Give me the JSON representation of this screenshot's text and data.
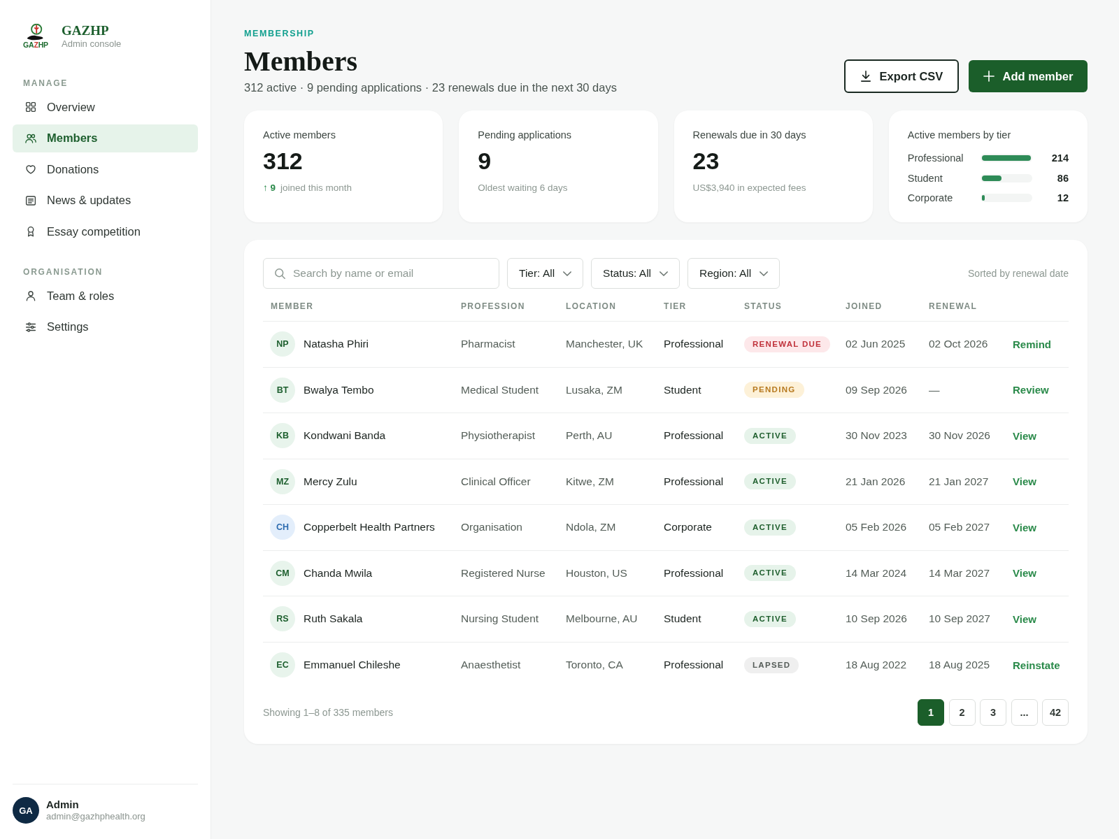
{
  "sidebar": {
    "brand": {
      "logo_text": [
        {
          "text": "GA",
          "color": "#1d6b2f"
        },
        {
          "text": "Z",
          "color": "#c8362e"
        },
        {
          "text": "HP",
          "color": "#1d6b2f"
        }
      ],
      "name": "GAZHP",
      "subtitle": "Admin console"
    },
    "sections": [
      {
        "heading": "MANAGE",
        "items": [
          {
            "label": "Overview",
            "selected": false
          },
          {
            "label": "Members",
            "selected": true
          },
          {
            "label": "Donations",
            "selected": false
          },
          {
            "label": "News & updates",
            "selected": false
          },
          {
            "label": "Essay competition",
            "selected": false
          }
        ]
      },
      {
        "heading": "ORGANISATION",
        "items": [
          {
            "label": "Team & roles",
            "selected": false
          },
          {
            "label": "Settings",
            "selected": false
          }
        ]
      }
    ],
    "user": {
      "initials": "GA",
      "name": "Admin",
      "email": "admin@gazhphealth.org"
    }
  },
  "header": {
    "eyebrow": "MEMBERSHIP",
    "title": "Members",
    "subtitle": "312 active · 9 pending applications · 23 renewals due in the next 30 days",
    "buttons": [
      {
        "label": "Export CSV",
        "kind": "secondary"
      },
      {
        "label": "Add member",
        "kind": "primary"
      }
    ]
  },
  "stat_cards": [
    {
      "kind": "stat",
      "label": "Active members",
      "value": "312",
      "delta": "↑ 9",
      "note": "joined this month"
    },
    {
      "kind": "stat",
      "label": "Pending applications",
      "value": "9",
      "note": "Oldest waiting 6 days"
    },
    {
      "kind": "stat",
      "label": "Renewals due in 30 days",
      "value": "23",
      "note": "US$3,940 in expected fees"
    },
    {
      "kind": "breakdown",
      "label": "Active members by tier",
      "rows": [
        {
          "label": "Professional",
          "level": 1,
          "value": "214"
        },
        {
          "label": "Student",
          "level": 0.4,
          "value": "86"
        },
        {
          "label": "Corporate",
          "level": 0.06,
          "value": "12"
        }
      ]
    }
  ],
  "table": {
    "search": {
      "placeholder": "Search by name or email"
    },
    "filters": [
      "Tier: All",
      "Status: All",
      "Region: All"
    ],
    "sort_note": "Sorted by renewal date",
    "columns": [
      "MEMBER",
      "PROFESSION",
      "LOCATION",
      "TIER",
      "STATUS",
      "JOINED",
      "RENEWAL"
    ],
    "rows": [
      {
        "kind": "person",
        "initials": "NP",
        "name": "Natasha Phiri",
        "profession": "Pharmacist",
        "location": "Manchester, UK",
        "tier": "Professional",
        "status": {
          "label": "RENEWAL DUE",
          "kind": "renewal_due"
        },
        "joined": "02 Jun 2025",
        "renewal": "02 Oct 2026",
        "action": "Remind"
      },
      {
        "kind": "person",
        "initials": "BT",
        "name": "Bwalya Tembo",
        "profession": "Medical Student",
        "location": "Lusaka, ZM",
        "tier": "Student",
        "status": {
          "label": "PENDING",
          "kind": "pending"
        },
        "joined": "09 Sep 2026",
        "renewal": "—",
        "action": "Review"
      },
      {
        "kind": "person",
        "initials": "KB",
        "name": "Kondwani Banda",
        "profession": "Physiotherapist",
        "location": "Perth, AU",
        "tier": "Professional",
        "status": {
          "label": "ACTIVE",
          "kind": "active"
        },
        "joined": "30 Nov 2023",
        "renewal": "30 Nov 2026",
        "action": "View"
      },
      {
        "kind": "person",
        "initials": "MZ",
        "name": "Mercy Zulu",
        "profession": "Clinical Officer",
        "location": "Kitwe, ZM",
        "tier": "Professional",
        "status": {
          "label": "ACTIVE",
          "kind": "active"
        },
        "joined": "21 Jan 2026",
        "renewal": "21 Jan 2027",
        "action": "View"
      },
      {
        "kind": "organisation",
        "initials": "CH",
        "name": "Copperbelt Health Partners",
        "profession": "Organisation",
        "location": "Ndola, ZM",
        "tier": "Corporate",
        "status": {
          "label": "ACTIVE",
          "kind": "active"
        },
        "joined": "05 Feb 2026",
        "renewal": "05 Feb 2027",
        "action": "View"
      },
      {
        "kind": "person",
        "initials": "CM",
        "name": "Chanda Mwila",
        "profession": "Registered Nurse",
        "location": "Houston, US",
        "tier": "Professional",
        "status": {
          "label": "ACTIVE",
          "kind": "active"
        },
        "joined": "14 Mar 2024",
        "renewal": "14 Mar 2027",
        "action": "View"
      },
      {
        "kind": "person",
        "initials": "RS",
        "name": "Ruth Sakala",
        "profession": "Nursing Student",
        "location": "Melbourne, AU",
        "tier": "Student",
        "status": {
          "label": "ACTIVE",
          "kind": "active"
        },
        "joined": "10 Sep 2026",
        "renewal": "10 Sep 2027",
        "action": "View"
      },
      {
        "kind": "person",
        "initials": "EC",
        "name": "Emmanuel Chileshe",
        "profession": "Anaesthetist",
        "location": "Toronto, CA",
        "tier": "Professional",
        "status": {
          "label": "LAPSED",
          "kind": "lapsed"
        },
        "joined": "18 Aug 2022",
        "renewal": "18 Aug 2025",
        "action": "Reinstate"
      }
    ],
    "footer": "Showing 1–8 of 335 members",
    "pages": [
      {
        "label": "1",
        "selected": true
      },
      {
        "label": "2",
        "selected": false
      },
      {
        "label": "3",
        "selected": false
      },
      {
        "label": "...",
        "selected": false
      },
      {
        "label": "42",
        "selected": false
      }
    ]
  }
}
